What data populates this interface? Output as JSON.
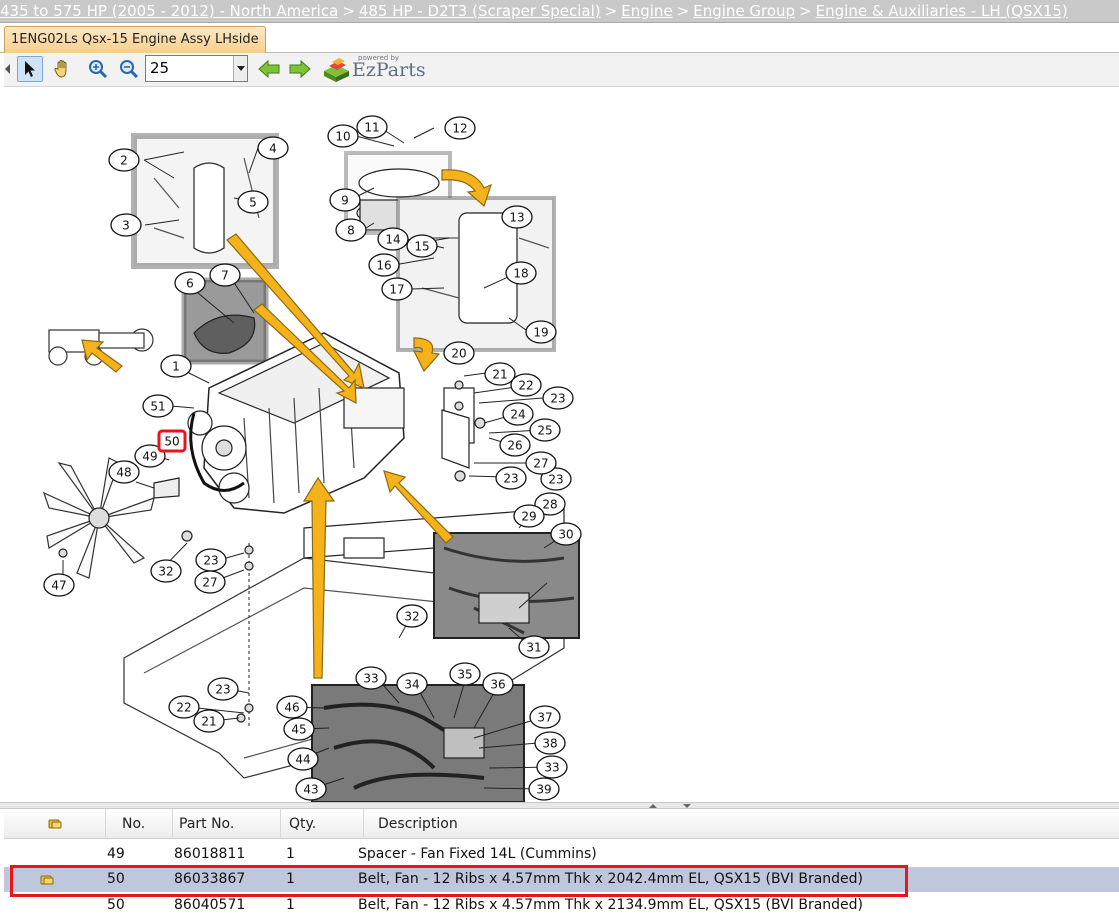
{
  "breadcrumb": {
    "items": [
      "435 to 575 HP (2005 - 2012) - North America",
      "485 HP - D2T3 (Scraper Special)",
      "Engine",
      "Engine Group",
      "Engine & Auxiliaries - LH (QSX15)"
    ],
    "separator": ">"
  },
  "tab": {
    "title": "1ENG02Ls Qsx-15 Engine Assy LHside"
  },
  "toolbar": {
    "zoom_value": "25",
    "icons": [
      "collapse-arrow-icon",
      "pointer-icon",
      "hand-icon",
      "zoom-in-icon",
      "zoom-out-icon",
      "back-arrow-icon",
      "forward-arrow-icon"
    ],
    "logo_text": "EzParts",
    "logo_small": "powered by"
  },
  "diagram": {
    "callouts": [
      "1",
      "2",
      "3",
      "4",
      "5",
      "6",
      "7",
      "8",
      "9",
      "10",
      "11",
      "12",
      "13",
      "14",
      "15",
      "16",
      "17",
      "18",
      "19",
      "20",
      "21",
      "22",
      "23",
      "24",
      "25",
      "26",
      "27",
      "28",
      "29",
      "30",
      "31",
      "32",
      "33",
      "34",
      "35",
      "36",
      "37",
      "38",
      "39",
      "43",
      "44",
      "45",
      "46",
      "47",
      "48",
      "49",
      "50",
      "51"
    ],
    "highlighted_callout": "50",
    "colors": {
      "arrow": "#f5b21b",
      "arrow_stroke": "#8a6a10",
      "highlight": "#e8151b"
    }
  },
  "grid": {
    "columns": [
      "",
      "No.",
      "Part No.",
      "Qty.",
      "Description"
    ],
    "rows": [
      {
        "no": "49",
        "part": "86018811",
        "qty": "1",
        "desc": "Spacer - Fan Fixed 14L (Cummins)",
        "selected": false
      },
      {
        "no": "50",
        "part": "86033867",
        "qty": "1",
        "desc": "Belt, Fan - 12 Ribs x 4.57mm Thk x 2042.4mm EL, QSX15 (BVI Branded)",
        "selected": true
      },
      {
        "no": "50",
        "part": "86040571",
        "qty": "1",
        "desc": "Belt, Fan - 12 Ribs x 4.57mm Thk x 2134.9mm EL, QSX15 (BVI Branded)",
        "selected": false
      }
    ]
  }
}
